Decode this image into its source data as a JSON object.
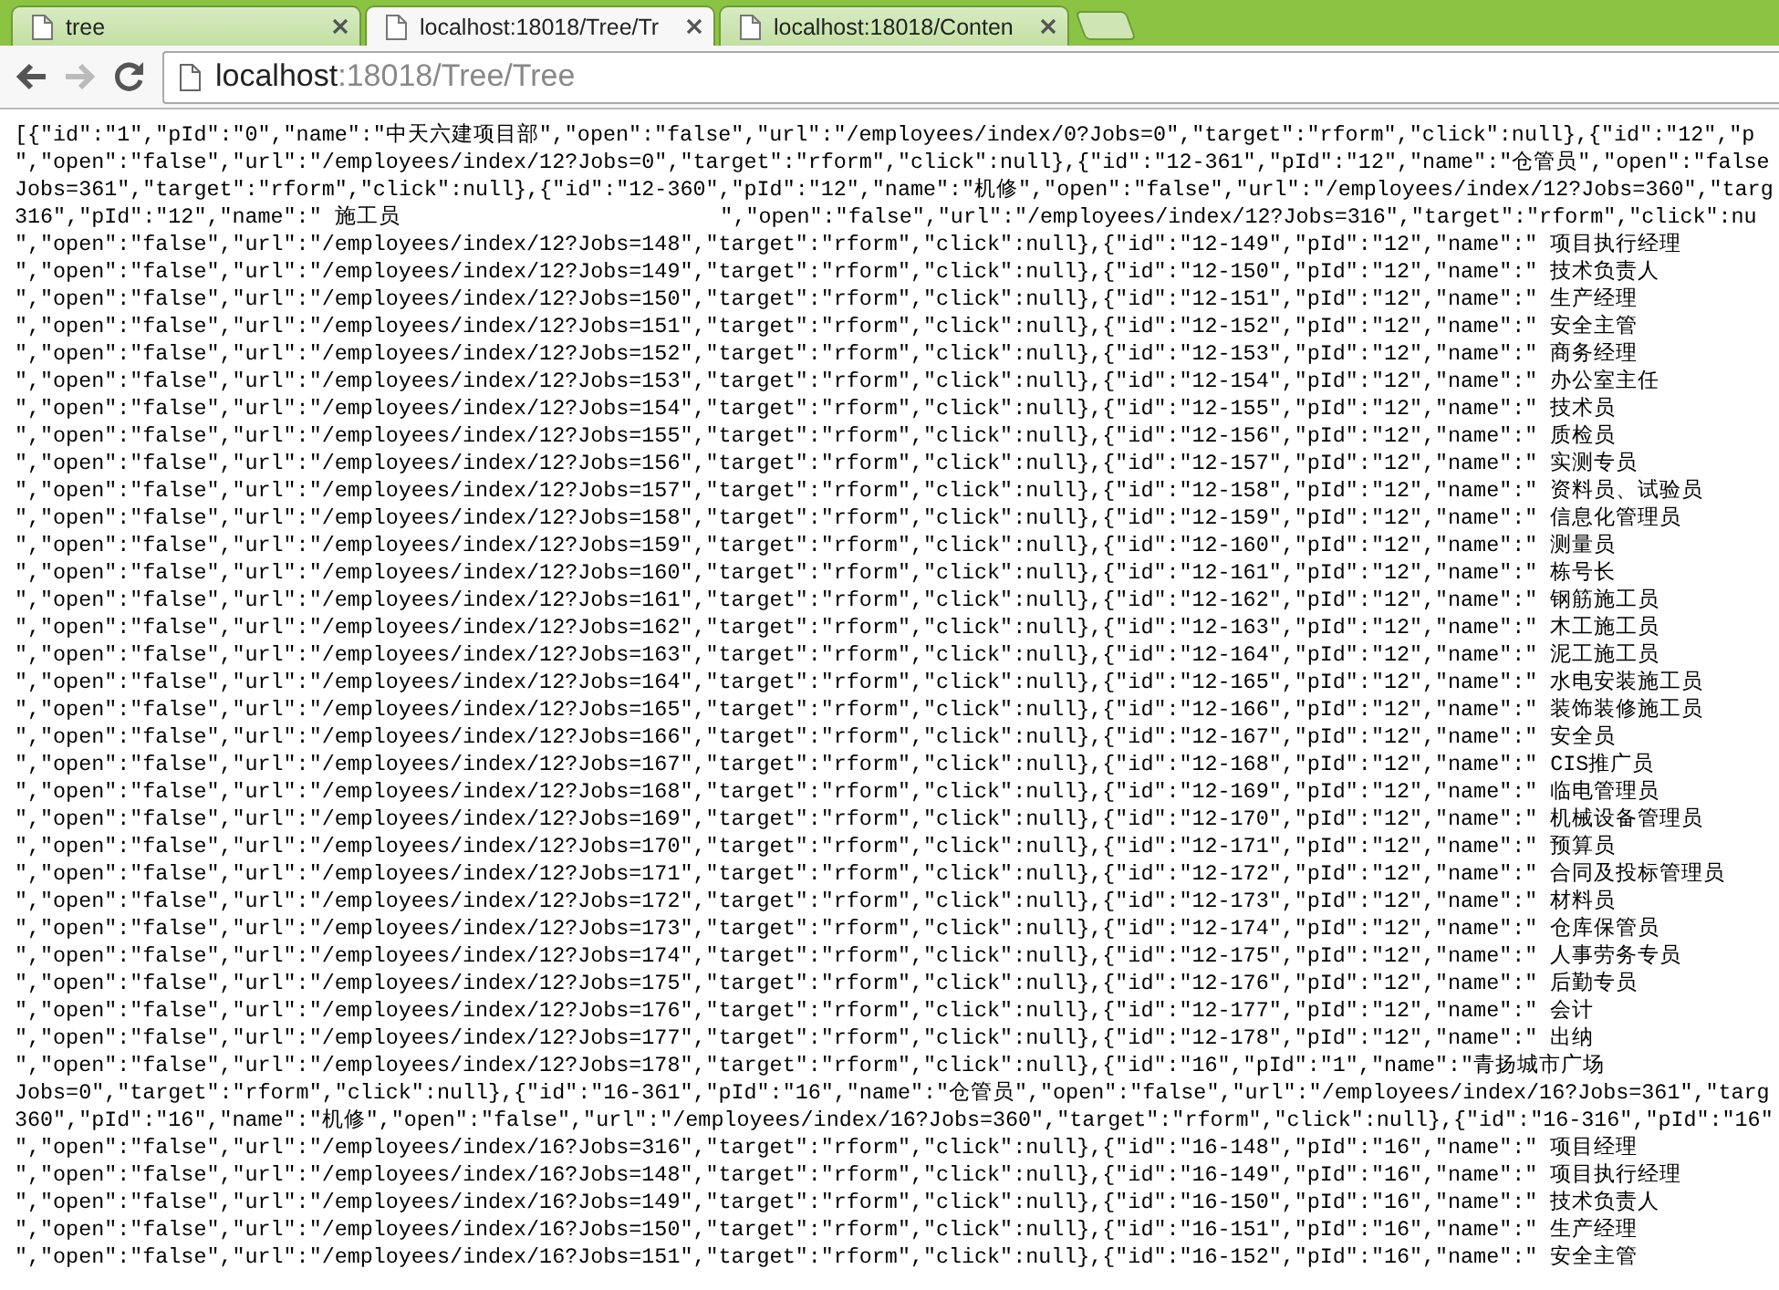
{
  "tabs": [
    {
      "title": "tree",
      "selected": false
    },
    {
      "title": "localhost:18018/Tree/Tr",
      "selected": true
    },
    {
      "title": "localhost:18018/Conten",
      "selected": false
    }
  ],
  "toolbar": {
    "back_disabled": false,
    "forward_disabled": true,
    "address_host": "localhost",
    "address_rest": ":18018/Tree/Tree"
  },
  "document": {
    "lines": [
      "[{\"id\":\"1\",\"pId\":\"0\",\"name\":\"中天六建项目部\",\"open\":\"false\",\"url\":\"/employees/index/0?Jobs=0\",\"target\":\"rform\",\"click\":null},{\"id\":\"12\",\"p",
      "\",\"open\":\"false\",\"url\":\"/employees/index/12?Jobs=0\",\"target\":\"rform\",\"click\":null},{\"id\":\"12-361\",\"pId\":\"12\",\"name\":\"仓管员\",\"open\":\"false",
      "Jobs=361\",\"target\":\"rform\",\"click\":null},{\"id\":\"12-360\",\"pId\":\"12\",\"name\":\"机修\",\"open\":\"false\",\"url\":\"/employees/index/12?Jobs=360\",\"targ",
      "316\",\"pId\":\"12\",\"name\":\" 施工员                         \",\"open\":\"false\",\"url\":\"/employees/index/12?Jobs=316\",\"target\":\"rform\",\"click\":nu",
      "\",\"open\":\"false\",\"url\":\"/employees/index/12?Jobs=148\",\"target\":\"rform\",\"click\":null},{\"id\":\"12-149\",\"pId\":\"12\",\"name\":\" 项目执行经理",
      "\",\"open\":\"false\",\"url\":\"/employees/index/12?Jobs=149\",\"target\":\"rform\",\"click\":null},{\"id\":\"12-150\",\"pId\":\"12\",\"name\":\" 技术负责人",
      "\",\"open\":\"false\",\"url\":\"/employees/index/12?Jobs=150\",\"target\":\"rform\",\"click\":null},{\"id\":\"12-151\",\"pId\":\"12\",\"name\":\" 生产经理",
      "\",\"open\":\"false\",\"url\":\"/employees/index/12?Jobs=151\",\"target\":\"rform\",\"click\":null},{\"id\":\"12-152\",\"pId\":\"12\",\"name\":\" 安全主管",
      "\",\"open\":\"false\",\"url\":\"/employees/index/12?Jobs=152\",\"target\":\"rform\",\"click\":null},{\"id\":\"12-153\",\"pId\":\"12\",\"name\":\" 商务经理",
      "\",\"open\":\"false\",\"url\":\"/employees/index/12?Jobs=153\",\"target\":\"rform\",\"click\":null},{\"id\":\"12-154\",\"pId\":\"12\",\"name\":\" 办公室主任",
      "\",\"open\":\"false\",\"url\":\"/employees/index/12?Jobs=154\",\"target\":\"rform\",\"click\":null},{\"id\":\"12-155\",\"pId\":\"12\",\"name\":\" 技术员",
      "\",\"open\":\"false\",\"url\":\"/employees/index/12?Jobs=155\",\"target\":\"rform\",\"click\":null},{\"id\":\"12-156\",\"pId\":\"12\",\"name\":\" 质检员",
      "\",\"open\":\"false\",\"url\":\"/employees/index/12?Jobs=156\",\"target\":\"rform\",\"click\":null},{\"id\":\"12-157\",\"pId\":\"12\",\"name\":\" 实测专员",
      "\",\"open\":\"false\",\"url\":\"/employees/index/12?Jobs=157\",\"target\":\"rform\",\"click\":null},{\"id\":\"12-158\",\"pId\":\"12\",\"name\":\" 资料员、试验员",
      "\",\"open\":\"false\",\"url\":\"/employees/index/12?Jobs=158\",\"target\":\"rform\",\"click\":null},{\"id\":\"12-159\",\"pId\":\"12\",\"name\":\" 信息化管理员",
      "\",\"open\":\"false\",\"url\":\"/employees/index/12?Jobs=159\",\"target\":\"rform\",\"click\":null},{\"id\":\"12-160\",\"pId\":\"12\",\"name\":\" 测量员",
      "\",\"open\":\"false\",\"url\":\"/employees/index/12?Jobs=160\",\"target\":\"rform\",\"click\":null},{\"id\":\"12-161\",\"pId\":\"12\",\"name\":\" 栋号长",
      "\",\"open\":\"false\",\"url\":\"/employees/index/12?Jobs=161\",\"target\":\"rform\",\"click\":null},{\"id\":\"12-162\",\"pId\":\"12\",\"name\":\" 钢筋施工员",
      "\",\"open\":\"false\",\"url\":\"/employees/index/12?Jobs=162\",\"target\":\"rform\",\"click\":null},{\"id\":\"12-163\",\"pId\":\"12\",\"name\":\" 木工施工员",
      "\",\"open\":\"false\",\"url\":\"/employees/index/12?Jobs=163\",\"target\":\"rform\",\"click\":null},{\"id\":\"12-164\",\"pId\":\"12\",\"name\":\" 泥工施工员",
      "\",\"open\":\"false\",\"url\":\"/employees/index/12?Jobs=164\",\"target\":\"rform\",\"click\":null},{\"id\":\"12-165\",\"pId\":\"12\",\"name\":\" 水电安装施工员",
      "\",\"open\":\"false\",\"url\":\"/employees/index/12?Jobs=165\",\"target\":\"rform\",\"click\":null},{\"id\":\"12-166\",\"pId\":\"12\",\"name\":\" 装饰装修施工员",
      "\",\"open\":\"false\",\"url\":\"/employees/index/12?Jobs=166\",\"target\":\"rform\",\"click\":null},{\"id\":\"12-167\",\"pId\":\"12\",\"name\":\" 安全员",
      "\",\"open\":\"false\",\"url\":\"/employees/index/12?Jobs=167\",\"target\":\"rform\",\"click\":null},{\"id\":\"12-168\",\"pId\":\"12\",\"name\":\" CIS推广员",
      "\",\"open\":\"false\",\"url\":\"/employees/index/12?Jobs=168\",\"target\":\"rform\",\"click\":null},{\"id\":\"12-169\",\"pId\":\"12\",\"name\":\" 临电管理员",
      "\",\"open\":\"false\",\"url\":\"/employees/index/12?Jobs=169\",\"target\":\"rform\",\"click\":null},{\"id\":\"12-170\",\"pId\":\"12\",\"name\":\" 机械设备管理员",
      "\",\"open\":\"false\",\"url\":\"/employees/index/12?Jobs=170\",\"target\":\"rform\",\"click\":null},{\"id\":\"12-171\",\"pId\":\"12\",\"name\":\" 预算员",
      "\",\"open\":\"false\",\"url\":\"/employees/index/12?Jobs=171\",\"target\":\"rform\",\"click\":null},{\"id\":\"12-172\",\"pId\":\"12\",\"name\":\" 合同及投标管理员",
      "\",\"open\":\"false\",\"url\":\"/employees/index/12?Jobs=172\",\"target\":\"rform\",\"click\":null},{\"id\":\"12-173\",\"pId\":\"12\",\"name\":\" 材料员",
      "\",\"open\":\"false\",\"url\":\"/employees/index/12?Jobs=173\",\"target\":\"rform\",\"click\":null},{\"id\":\"12-174\",\"pId\":\"12\",\"name\":\" 仓库保管员",
      "\",\"open\":\"false\",\"url\":\"/employees/index/12?Jobs=174\",\"target\":\"rform\",\"click\":null},{\"id\":\"12-175\",\"pId\":\"12\",\"name\":\" 人事劳务专员",
      "\",\"open\":\"false\",\"url\":\"/employees/index/12?Jobs=175\",\"target\":\"rform\",\"click\":null},{\"id\":\"12-176\",\"pId\":\"12\",\"name\":\" 后勤专员",
      "\",\"open\":\"false\",\"url\":\"/employees/index/12?Jobs=176\",\"target\":\"rform\",\"click\":null},{\"id\":\"12-177\",\"pId\":\"12\",\"name\":\" 会计",
      "\",\"open\":\"false\",\"url\":\"/employees/index/12?Jobs=177\",\"target\":\"rform\",\"click\":null},{\"id\":\"12-178\",\"pId\":\"12\",\"name\":\" 出纳",
      "\",\"open\":\"false\",\"url\":\"/employees/index/12?Jobs=178\",\"target\":\"rform\",\"click\":null},{\"id\":\"16\",\"pId\":\"1\",\"name\":\"青扬城市广场",
      "Jobs=0\",\"target\":\"rform\",\"click\":null},{\"id\":\"16-361\",\"pId\":\"16\",\"name\":\"仓管员\",\"open\":\"false\",\"url\":\"/employees/index/16?Jobs=361\",\"targ",
      "360\",\"pId\":\"16\",\"name\":\"机修\",\"open\":\"false\",\"url\":\"/employees/index/16?Jobs=360\",\"target\":\"rform\",\"click\":null},{\"id\":\"16-316\",\"pId\":\"16\"",
      "\",\"open\":\"false\",\"url\":\"/employees/index/16?Jobs=316\",\"target\":\"rform\",\"click\":null},{\"id\":\"16-148\",\"pId\":\"16\",\"name\":\" 项目经理",
      "\",\"open\":\"false\",\"url\":\"/employees/index/16?Jobs=148\",\"target\":\"rform\",\"click\":null},{\"id\":\"16-149\",\"pId\":\"16\",\"name\":\" 项目执行经理",
      "\",\"open\":\"false\",\"url\":\"/employees/index/16?Jobs=149\",\"target\":\"rform\",\"click\":null},{\"id\":\"16-150\",\"pId\":\"16\",\"name\":\" 技术负责人",
      "\",\"open\":\"false\",\"url\":\"/employees/index/16?Jobs=150\",\"target\":\"rform\",\"click\":null},{\"id\":\"16-151\",\"pId\":\"16\",\"name\":\" 生产经理",
      "\",\"open\":\"false\",\"url\":\"/employees/index/16?Jobs=151\",\"target\":\"rform\",\"click\":null},{\"id\":\"16-152\",\"pId\":\"16\",\"name\":\" 安全主管"
    ]
  }
}
